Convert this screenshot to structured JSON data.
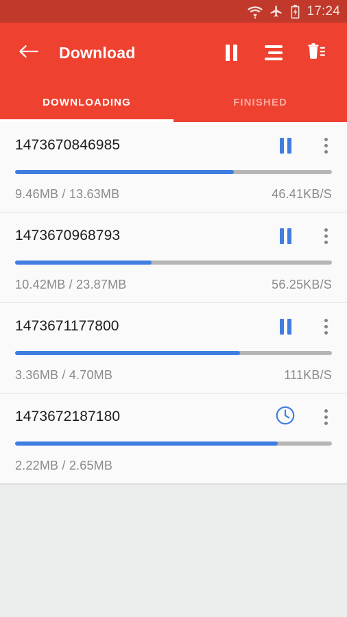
{
  "statusbar": {
    "time": "17:24",
    "icons": [
      "wifi-icon",
      "airplane-mode-icon",
      "battery-charging-icon"
    ]
  },
  "appbar": {
    "back_label": "back-arrow",
    "title": "Download",
    "actions": [
      {
        "name": "pause-all-button",
        "label": "Pause all"
      },
      {
        "name": "sort-button",
        "label": "Sort"
      },
      {
        "name": "delete-button",
        "label": "Delete"
      }
    ]
  },
  "tabs": [
    {
      "label": "DOWNLOADING",
      "active": true
    },
    {
      "label": "FINISHED",
      "active": false
    }
  ],
  "colors": {
    "appbar": "#ef4130",
    "statusbar": "#c0392b",
    "progress_fill": "#3f7ee0",
    "progress_track": "#b6b6b6",
    "list_background": "#fafafa",
    "page_background": "#eceded"
  },
  "downloads": [
    {
      "name": "1473670846985",
      "state_icon": "pause-icon",
      "progress": 69,
      "size": "9.46MB / 13.63MB",
      "speed": "46.41KB/S"
    },
    {
      "name": "1473670968793",
      "state_icon": "pause-icon",
      "progress": 43,
      "size": "10.42MB / 23.87MB",
      "speed": "56.25KB/S"
    },
    {
      "name": "1473671177800",
      "state_icon": "pause-icon",
      "progress": 71,
      "size": "3.36MB / 4.70MB",
      "speed": "111KB/S"
    },
    {
      "name": "1473672187180",
      "state_icon": "clock-icon",
      "progress": 83,
      "size": "2.22MB / 2.65MB",
      "speed": ""
    }
  ]
}
